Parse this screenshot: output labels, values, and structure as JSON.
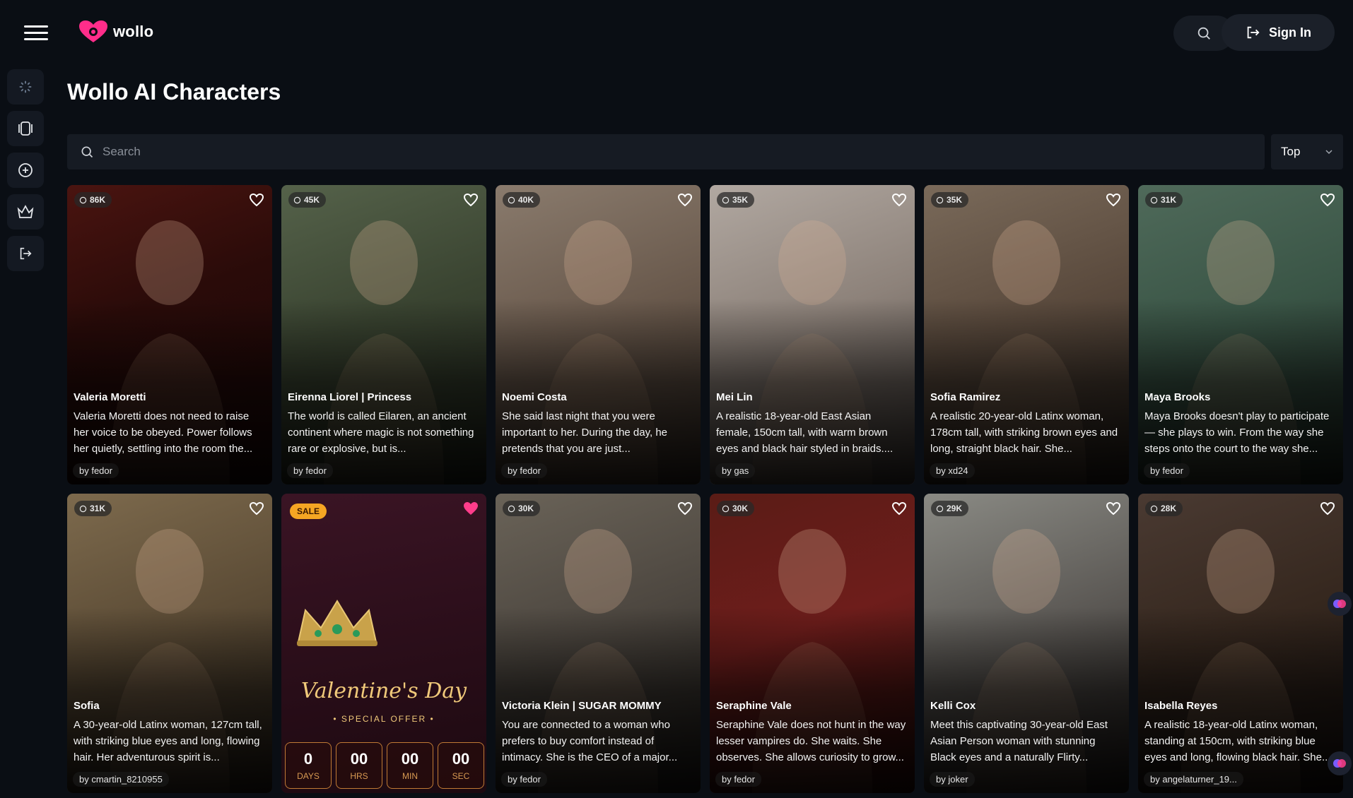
{
  "brand": {
    "name": "wollo"
  },
  "header": {
    "signin_label": "Sign In"
  },
  "sidebar": {
    "items": [
      "sparkle-icon",
      "cards-icon",
      "plus-circle-icon",
      "crown-icon",
      "logout-icon"
    ]
  },
  "page": {
    "title": "Wollo AI Characters"
  },
  "search": {
    "placeholder": "Search",
    "sort_value": "Top"
  },
  "colors": {
    "background": "#0a0e14",
    "panel": "#161b23",
    "accent_pink": "#ff3d8b",
    "sale": "#f5a623"
  },
  "cards": [
    {
      "count": "86K",
      "name": "Valeria Moretti",
      "desc": "Valeria Moretti does not need to raise her voice to be obeyed. Power follows her quietly, settling into the room the...",
      "author": "by fedor",
      "bg": "linear-gradient(160deg,#4a1410 0%,#2a0b09 40%,#1a0707 100%)"
    },
    {
      "count": "45K",
      "name": "Eirenna Liorel | Princess",
      "desc": "The world is called Eilaren, an ancient continent where magic is not something rare or explosive, but is...",
      "author": "by fedor",
      "bg": "linear-gradient(160deg,#55624a 0%,#3a4431 45%,#242a1f 100%)"
    },
    {
      "count": "40K",
      "name": "Noemi Costa",
      "desc": "She said last night that you were important to her. During the day, he pretends that you are just...",
      "author": "by fedor",
      "bg": "linear-gradient(160deg,#8a7b6d 0%,#6a5a4d 45%,#3c3129 100%)"
    },
    {
      "count": "35K",
      "name": "Mei Lin",
      "desc": "A realistic 18-year-old East Asian female, 150cm tall, with warm brown eyes and black hair styled in braids....",
      "author": "by gas",
      "bg": "linear-gradient(160deg,#b1a8a1 0%,#8d827a 45%,#4b4440 100%)"
    },
    {
      "count": "35K",
      "name": "Sofia Ramirez",
      "desc": "A realistic 20-year-old Latinx woman, 178cm tall, with striking brown eyes and long, straight black hair. She...",
      "author": "by xd24",
      "bg": "linear-gradient(160deg,#7a6a5a 0%,#5a4a3d 45%,#2e2620 100%)"
    },
    {
      "count": "31K",
      "name": "Maya Brooks",
      "desc": "Maya Brooks doesn't play to participate — she plays to win. From the way she steps onto the court to the way she...",
      "author": "by fedor",
      "bg": "linear-gradient(160deg,#4f6a5a 0%,#3a5546 45%,#1f2c25 100%)"
    },
    {
      "count": "31K",
      "name": "Sofia",
      "desc": "A 30-year-old Latinx woman, 127cm tall, with striking blue eyes and long, flowing hair. Her adventurous spirit is...",
      "author": "by cmartin_8210955",
      "bg": "linear-gradient(160deg,#7d6a4d 0%,#5c4c36 45%,#2e261c 100%)"
    },
    {
      "promo": true,
      "sale": "SALE",
      "title": "Valentine's Day",
      "subtitle": "• SPECIAL OFFER •",
      "countdown": [
        {
          "num": "0",
          "lbl": "DAYS"
        },
        {
          "num": "00",
          "lbl": "HRS"
        },
        {
          "num": "00",
          "lbl": "MIN"
        },
        {
          "num": "00",
          "lbl": "SEC"
        }
      ],
      "bg": "linear-gradient(170deg,#3a1424 0%,#2b0e1a 50%,#1c0910 100%)"
    },
    {
      "count": "30K",
      "name": "Victoria Klein | SUGAR MOMMY",
      "desc": "You are connected to a woman who prefers to buy comfort instead of intimacy. She is the CEO of a major...",
      "author": "by fedor",
      "bg": "linear-gradient(160deg,#6a6358 0%,#4d4740 45%,#211e1b 100%)"
    },
    {
      "count": "30K",
      "name": "Seraphine Vale",
      "desc": "Seraphine Vale does not hunt in the way lesser vampires do. She waits. She observes. She allows curiosity to grow...",
      "author": "by fedor",
      "bg": "linear-gradient(160deg,#5a1c16 0%,#6e1d1b 45%,#2a0b09 100%)"
    },
    {
      "count": "29K",
      "name": "Kelli Cox",
      "desc": "Meet this captivating 30-year-old East Asian Person woman with stunning Black eyes and a naturally Flirty...",
      "author": "by joker",
      "bg": "linear-gradient(160deg,#8a8a84 0%,#5d5a56 45%,#241f1d 100%)"
    },
    {
      "count": "28K",
      "name": "Isabella Reyes",
      "desc": "A realistic 18-year-old Latinx woman, standing at 150cm, with striking blue eyes and long, flowing black hair. She...",
      "author": "by angelaturner_19...",
      "bg": "linear-gradient(160deg,#4a3a32 0%,#36281f 45%,#1a1310 100%)"
    }
  ]
}
